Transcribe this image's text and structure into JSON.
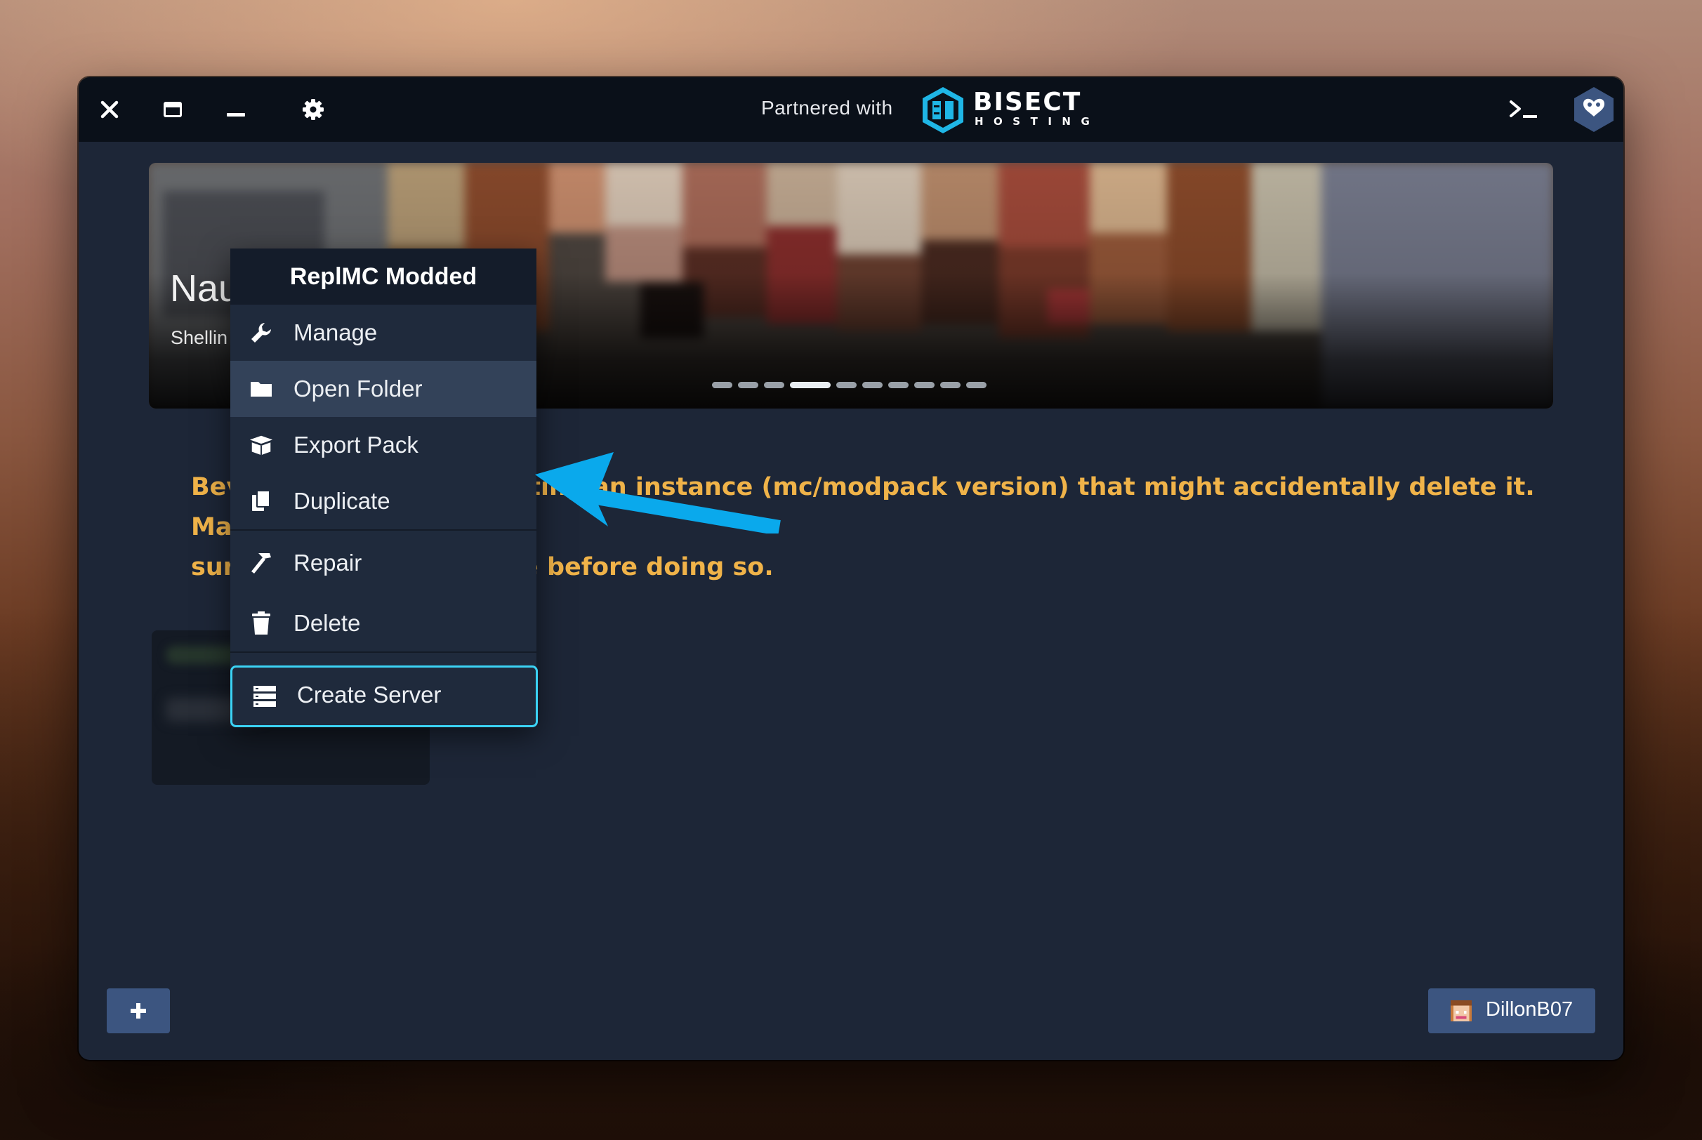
{
  "header": {
    "partner_label": "Partnered with",
    "partner_brand": "BISECT",
    "partner_brand_sub": "HOSTING"
  },
  "banner": {
    "title": "Nau",
    "subtitle": "Shellin",
    "slides_total": 10,
    "active_slide_index": 3
  },
  "warning": {
    "line1_left": "Bev",
    "line1_right": "ting an instance (mc/modpack version) that might accidentally delete it. Make",
    "line2_left": "sur",
    "line2_right": "e before doing so."
  },
  "context_menu": {
    "title": "ReplMC Modded",
    "items": [
      {
        "label": "Manage",
        "icon": "wrench-icon"
      },
      {
        "label": "Open Folder",
        "icon": "folder-icon"
      },
      {
        "label": "Export Pack",
        "icon": "box-icon"
      },
      {
        "label": "Duplicate",
        "icon": "copy-icon"
      },
      {
        "label": "Repair",
        "icon": "hammer-icon"
      },
      {
        "label": "Delete",
        "icon": "trash-icon"
      }
    ],
    "create_server_label": "Create Server"
  },
  "footer": {
    "add_label": "+",
    "username": "DillonB07"
  },
  "colors": {
    "accent_cyan": "#3bd3f5",
    "warning_orange": "#f0b349",
    "arrow_blue": "#0aa9ec",
    "button_blue": "#3c5580"
  }
}
